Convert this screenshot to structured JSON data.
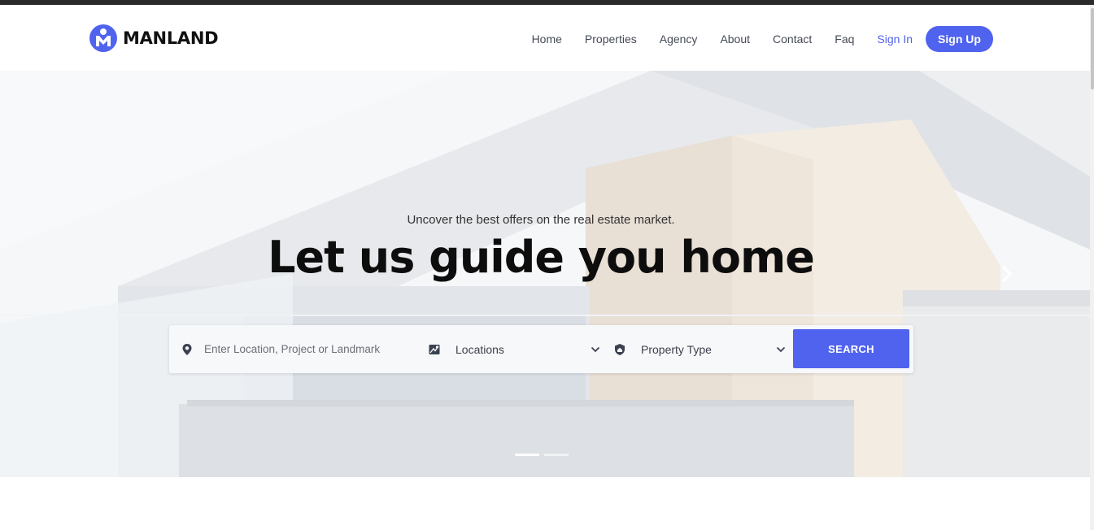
{
  "brand": {
    "name": "MANLAND",
    "color": "#5063ee"
  },
  "nav": {
    "items": [
      {
        "label": "Home"
      },
      {
        "label": "Properties"
      },
      {
        "label": "Agency"
      },
      {
        "label": "About"
      },
      {
        "label": "Contact"
      },
      {
        "label": "Faq"
      }
    ],
    "signin_label": "Sign In",
    "signup_label": "Sign Up"
  },
  "hero": {
    "tagline": "Uncover the best offers on the real estate market.",
    "headline": "Let us guide you home",
    "slides": {
      "count": 2,
      "active": 1
    }
  },
  "search": {
    "location_placeholder": "Enter Location, Project or Landmark",
    "locations_value": "Locations",
    "property_type_value": "Property Type",
    "button_label": "SEARCH"
  },
  "icons": {
    "location": "map-pin-icon",
    "locations": "map-icon",
    "property_type": "house-shield-icon",
    "dropdown": "chevron-down-icon",
    "next": "chevron-right-icon"
  }
}
